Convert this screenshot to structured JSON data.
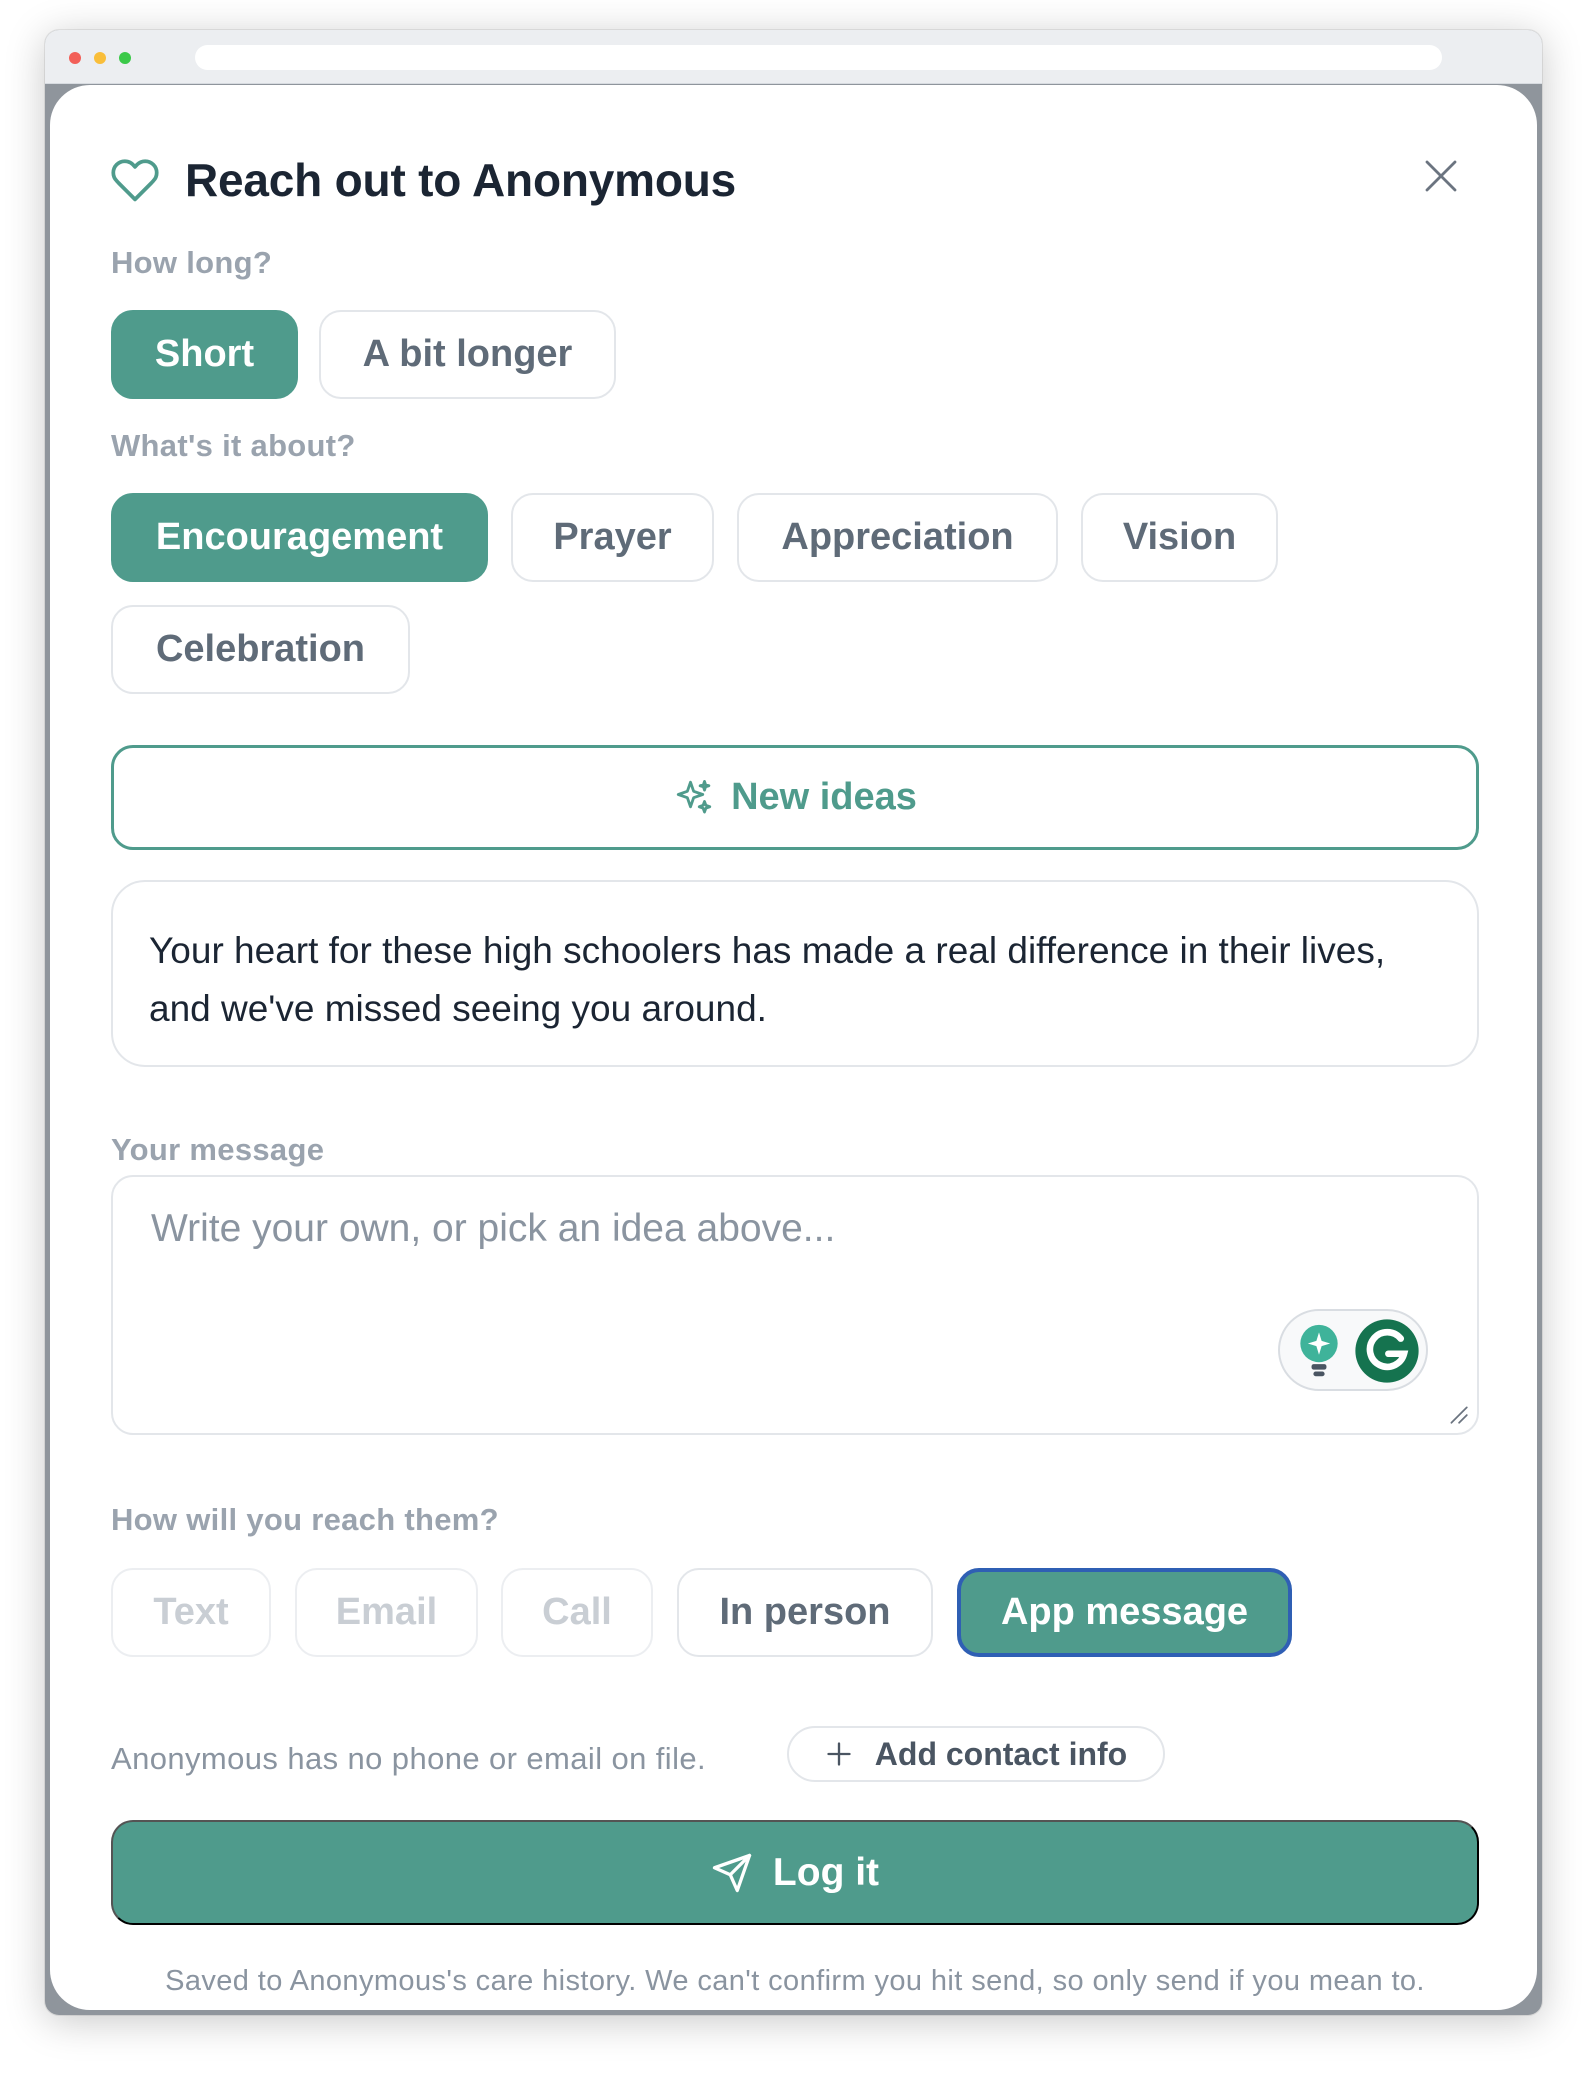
{
  "modal": {
    "title": "Reach out to Anonymous",
    "length_label": "How long?",
    "length_options": [
      {
        "label": "Short",
        "selected": true
      },
      {
        "label": "A bit longer",
        "selected": false
      }
    ],
    "topic_label": "What's it about?",
    "topic_options": [
      {
        "label": "Encouragement",
        "selected": true
      },
      {
        "label": "Prayer",
        "selected": false
      },
      {
        "label": "Appreciation",
        "selected": false
      },
      {
        "label": "Vision",
        "selected": false
      },
      {
        "label": "Celebration",
        "selected": false
      }
    ],
    "new_ideas_label": "New ideas",
    "idea_text": "Your heart for these high schoolers has made a real difference in their lives, and we've missed seeing you around.",
    "message_label": "Your message",
    "message_placeholder": "Write your own, or pick an idea above...",
    "message_value": "",
    "channel_label": "How will you reach them?",
    "channel_options": [
      {
        "label": "Text",
        "state": "disabled"
      },
      {
        "label": "Email",
        "state": "disabled"
      },
      {
        "label": "Call",
        "state": "disabled"
      },
      {
        "label": "In person",
        "state": "default"
      },
      {
        "label": "App message",
        "state": "selected"
      }
    ],
    "contact_note": "Anonymous has no phone or email on file.",
    "add_contact_label": "Add contact info",
    "log_button_label": "Log it",
    "footnote": "Saved to Anonymous's care history. We can't confirm you hit send, so only send if you mean to."
  },
  "icons": {
    "title_icon": "heart-icon",
    "close_icon": "close-icon",
    "new_ideas_icon": "sparkle-icon",
    "add_icon": "plus-icon",
    "send_icon": "send-icon",
    "grammarly_icons": [
      "lightbulb-icon",
      "grammarly-logo-icon"
    ]
  },
  "colors": {
    "accent": "#4f9b8c",
    "title_text": "#1b2533",
    "muted_text": "#9aa3ae",
    "focus_ring": "#2f5fb4",
    "window_traffic_lights": [
      "#f25f58",
      "#f9be3a",
      "#3bc949"
    ]
  }
}
